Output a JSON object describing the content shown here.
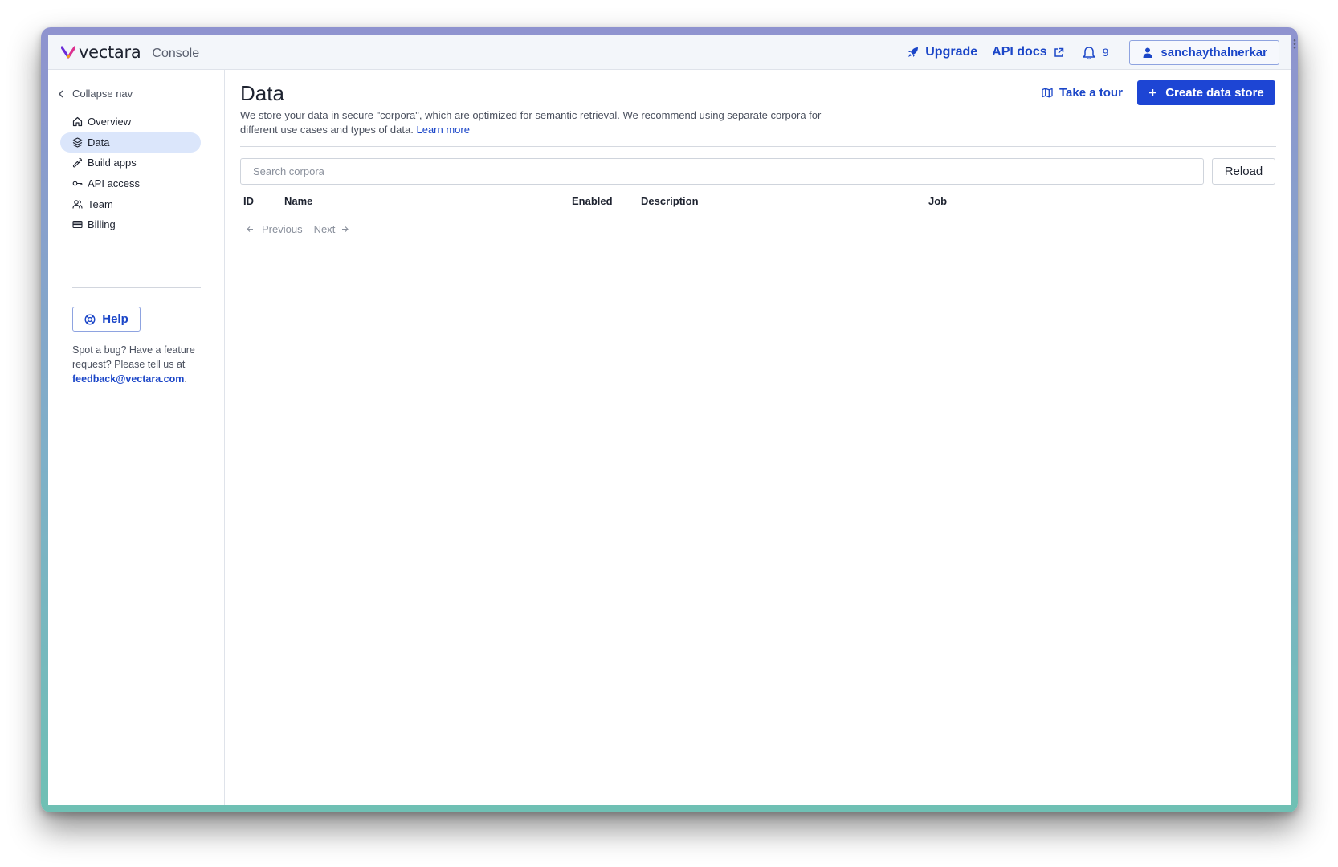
{
  "app": {
    "brand_name": "vectara",
    "console_label": "Console"
  },
  "topbar": {
    "upgrade_label": "Upgrade",
    "api_docs_label": "API docs",
    "notification_count": "9",
    "username": "sanchaythalnerkar",
    "icons": {
      "upgrade": "rocket-icon",
      "api_docs": "external-link-icon",
      "notifications": "bell-icon",
      "user": "user-icon"
    }
  },
  "sidebar": {
    "collapse_label": "Collapse nav",
    "items": [
      {
        "label": "Overview",
        "icon": "home-icon",
        "active": false
      },
      {
        "label": "Data",
        "icon": "layers-icon",
        "active": true
      },
      {
        "label": "Build apps",
        "icon": "wrench-icon",
        "active": false
      },
      {
        "label": "API access",
        "icon": "key-icon",
        "active": false
      },
      {
        "label": "Team",
        "icon": "users-icon",
        "active": false
      },
      {
        "label": "Billing",
        "icon": "credit-card-icon",
        "active": false
      }
    ],
    "help_label": "Help",
    "feedback_text": "Spot a bug? Have a feature request? Please tell us at",
    "feedback_email": "feedback@vectara.com",
    "feedback_suffix": "."
  },
  "main": {
    "title": "Data",
    "description": "We store your data in secure \"corpora\", which are optimized for semantic retrieval. We recommend using separate corpora for different use cases and types of data.",
    "learn_more_label": "Learn more",
    "tour_label": "Take a tour",
    "create_label": "Create data store",
    "search_placeholder": "Search corpora",
    "search_value": "",
    "reload_label": "Reload",
    "table": {
      "columns": [
        "ID",
        "Name",
        "Enabled",
        "Description",
        "Job"
      ],
      "rows": []
    },
    "pagination": {
      "previous_label": "Previous",
      "next_label": "Next"
    }
  },
  "colors": {
    "accent": "#1d45d4",
    "link": "#1b46c8",
    "active_nav_bg": "#dbe6fb",
    "topbar_bg": "#f3f6fa"
  }
}
